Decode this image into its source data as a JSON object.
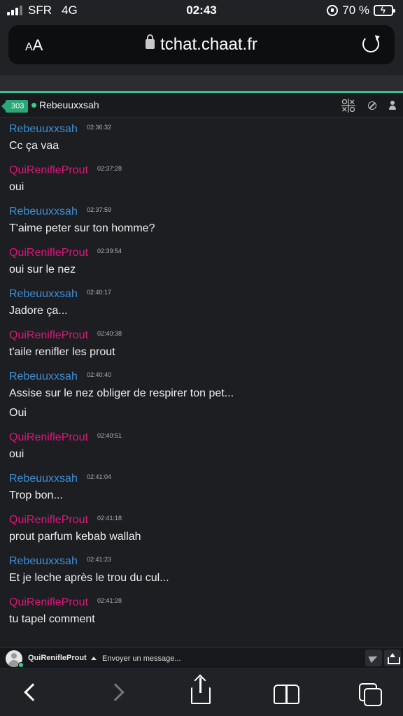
{
  "status_bar": {
    "carrier": "SFR",
    "network": "4G",
    "time": "02:43",
    "battery": "70 %",
    "battery_level": 0.7,
    "colors": {
      "battery_fill": "#f2c230"
    }
  },
  "address_bar": {
    "text_size_label": "AA",
    "url": "tchat.chaat.fr",
    "icons": [
      "lock-icon",
      "reload-icon"
    ]
  },
  "chat_header": {
    "user_count": "303",
    "username": "Rebeuuxxsah",
    "icons": [
      "tictactoe-icon",
      "ban-icon",
      "person-icon"
    ],
    "colors": {
      "accent": "#35c19a",
      "badge": "#2aa779",
      "online": "#35d08a"
    }
  },
  "messages": [
    {
      "author": "Rebeuuxxsah",
      "time": "02:36:32",
      "lines": [
        "Cc ça vaa"
      ],
      "color": "#3d8fd6"
    },
    {
      "author": "QuiRenifleProut",
      "time": "02:37:28",
      "lines": [
        "oui"
      ],
      "color": "#e0147a"
    },
    {
      "author": "Rebeuuxxsah",
      "time": "02:37:59",
      "lines": [
        "T'aime peter sur ton homme?"
      ],
      "color": "#3d8fd6"
    },
    {
      "author": "QuiRenifleProut",
      "time": "02:39:54",
      "lines": [
        "oui sur le nez"
      ],
      "color": "#e0147a"
    },
    {
      "author": "Rebeuuxxsah",
      "time": "02:40:17",
      "lines": [
        "Jadore ça..."
      ],
      "color": "#3d8fd6"
    },
    {
      "author": "QuiRenifleProut",
      "time": "02:40:38",
      "lines": [
        "t'aile renifler les prout"
      ],
      "color": "#e0147a"
    },
    {
      "author": "Rebeuuxxsah",
      "time": "02:40:40",
      "lines": [
        "Assise sur le nez obliger de respirer ton pet...",
        "Oui"
      ],
      "color": "#3d8fd6"
    },
    {
      "author": "QuiRenifleProut",
      "time": "02:40:51",
      "lines": [
        "oui"
      ],
      "color": "#e0147a"
    },
    {
      "author": "Rebeuuxxsah",
      "time": "02:41:04",
      "lines": [
        "Trop bon..."
      ],
      "color": "#3d8fd6"
    },
    {
      "author": "QuiRenifleProut",
      "time": "02:41:18",
      "lines": [
        "prout parfum kebab wallah"
      ],
      "color": "#e0147a"
    },
    {
      "author": "Rebeuuxxsah",
      "time": "02:41:23",
      "lines": [
        "Et je leche après le trou du cul..."
      ],
      "color": "#3d8fd6"
    },
    {
      "author": "QuiRenifleProut",
      "time": "02:41:28",
      "lines": [
        "tu tapel comment"
      ],
      "color": "#e0147a"
    }
  ],
  "composer": {
    "username": "QuiRenifleProut",
    "placeholder": "Envoyer un message...",
    "value": "",
    "icons": [
      "avatar",
      "caret-up-icon",
      "send-icon",
      "upload-icon"
    ]
  },
  "toolbar": {
    "icons": [
      "back-icon",
      "forward-icon",
      "share-icon",
      "bookmarks-icon",
      "tabs-icon"
    ]
  }
}
